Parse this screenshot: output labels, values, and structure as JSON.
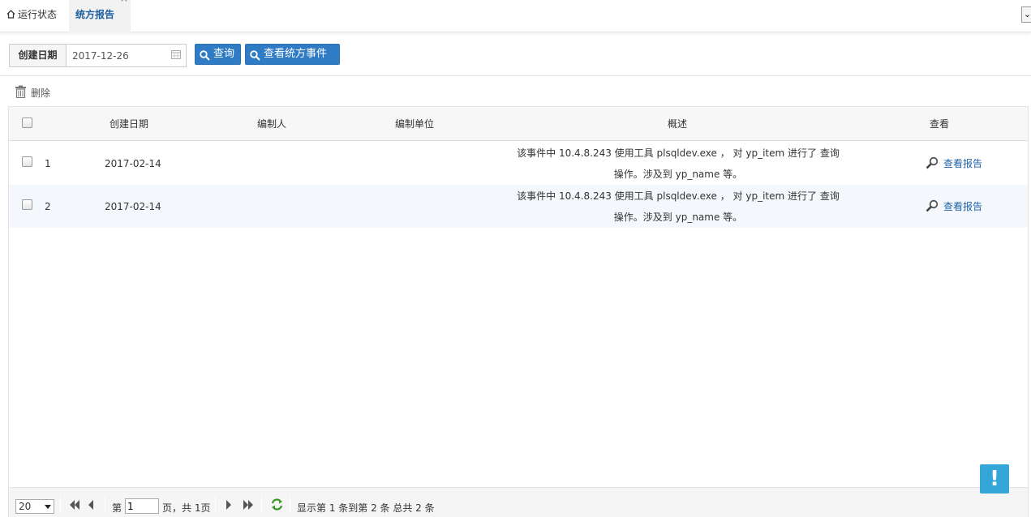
{
  "tabs": [
    {
      "label": "运行状态",
      "icon": "home-icon"
    },
    {
      "label": "统方报告",
      "active": true,
      "close": "×"
    }
  ],
  "tab_menu_glyph": "⌄",
  "search": {
    "date_label": "创建日期",
    "date_value": "2017-12-26",
    "query_button": "查询",
    "events_button": "查看统方事件"
  },
  "toolbar": {
    "delete_label": "删除"
  },
  "table": {
    "columns": [
      "创建日期",
      "编制人",
      "编制单位",
      "概述",
      "查看"
    ],
    "rows": [
      {
        "index": "1",
        "date": "2017-02-14",
        "author": "",
        "unit": "",
        "summary_line1": "该事件中 10.4.8.243 使用工具 plsqldev.exe ， 对 yp_item 进行了 查询",
        "summary_line2": "操作。涉及到 yp_name 等。",
        "view_label": "查看报告"
      },
      {
        "index": "2",
        "date": "2017-02-14",
        "author": "",
        "unit": "",
        "summary_line1": "该事件中 10.4.8.243 使用工具 plsqldev.exe ， 对 yp_item 进行了 查询",
        "summary_line2": "操作。涉及到 yp_name 等。",
        "view_label": "查看报告"
      }
    ]
  },
  "pager": {
    "page_size": "20",
    "page_prefix": "第",
    "page_value": "1",
    "page_suffix": "页，共 1页",
    "display_text": "显示第 1 条到第 2 条 总共 2 条"
  },
  "help_badge": "!",
  "colors": {
    "accent": "#2f7bc4",
    "link": "#1f62a8",
    "badge": "#34a7d8"
  }
}
